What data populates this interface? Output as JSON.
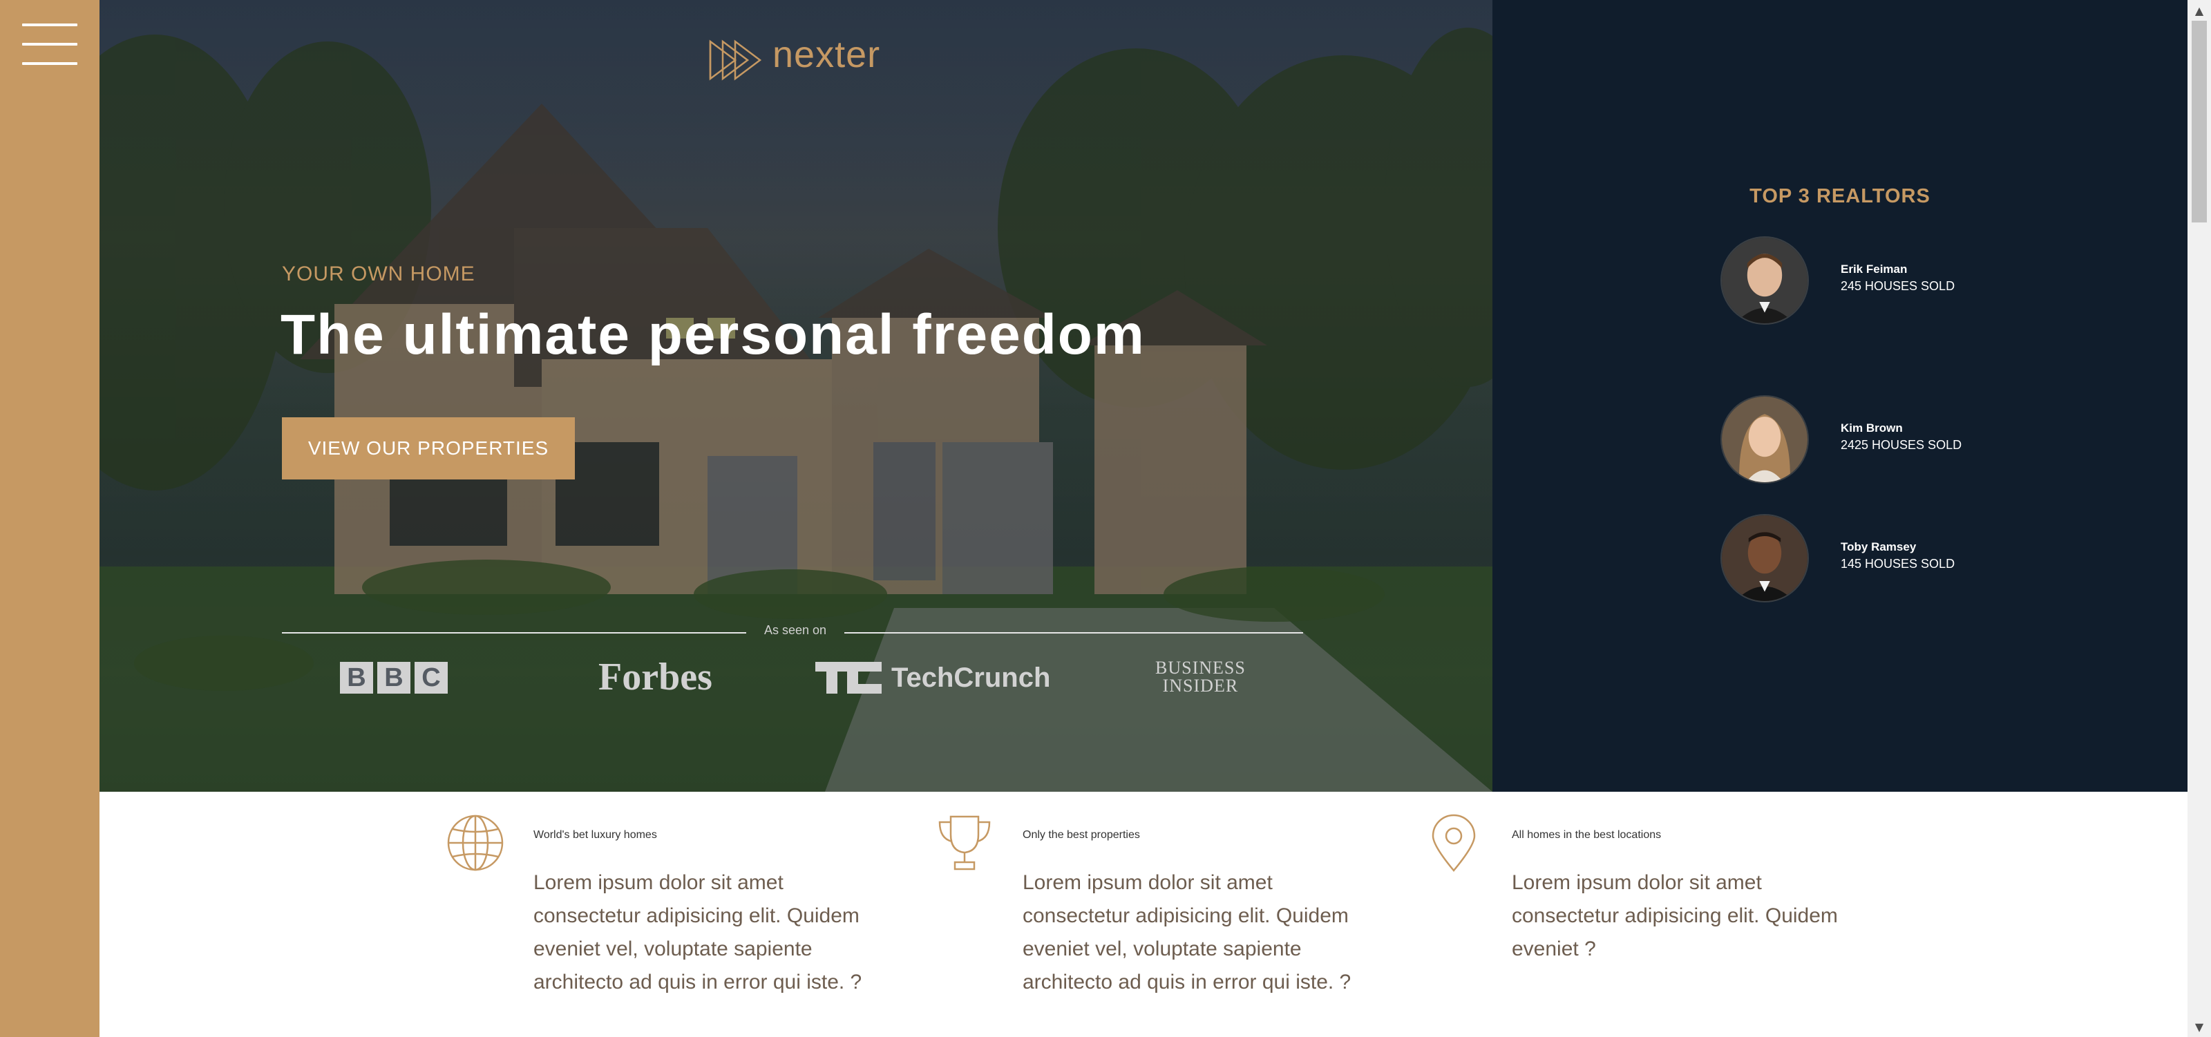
{
  "brand": {
    "name": "nexter",
    "accent_color": "#c69963",
    "dark_color": "#101d2c"
  },
  "nav": {
    "menu_icon": "hamburger-icon"
  },
  "hero": {
    "eyebrow": "YOUR OWN HOME",
    "title": "The ultimate personal freedom",
    "cta_label": "VIEW OUR PROPERTIES",
    "seen_on_label": "As seen on",
    "press_logos": [
      "BBC",
      "Forbes",
      "TechCrunch",
      "Business Insider"
    ]
  },
  "realtors": {
    "title": "TOP 3 REALTORS",
    "items": [
      {
        "name": "Erik Feiman",
        "sold": "245 HOUSES SOLD"
      },
      {
        "name": "Kim Brown",
        "sold": "2425 HOUSES SOLD"
      },
      {
        "name": "Toby Ramsey",
        "sold": "145 HOUSES SOLD"
      }
    ]
  },
  "features": [
    {
      "icon": "globe-icon",
      "title": "World's bet luxury homes",
      "text": "Lorem ipsum dolor sit amet consectetur adipisicing elit. Quidem eveniet vel, voluptate sapiente architecto ad quis in error qui iste. ?"
    },
    {
      "icon": "trophy-icon",
      "title": "Only the best properties",
      "text": "Lorem ipsum dolor sit amet consectetur adipisicing elit. Quidem eveniet vel, voluptate sapiente architecto ad quis in error qui iste. ?"
    },
    {
      "icon": "location-pin-icon",
      "title": "All homes in the best locations",
      "text": "Lorem ipsum dolor sit amet consectetur adipisicing elit. Quidem eveniet ?"
    }
  ]
}
